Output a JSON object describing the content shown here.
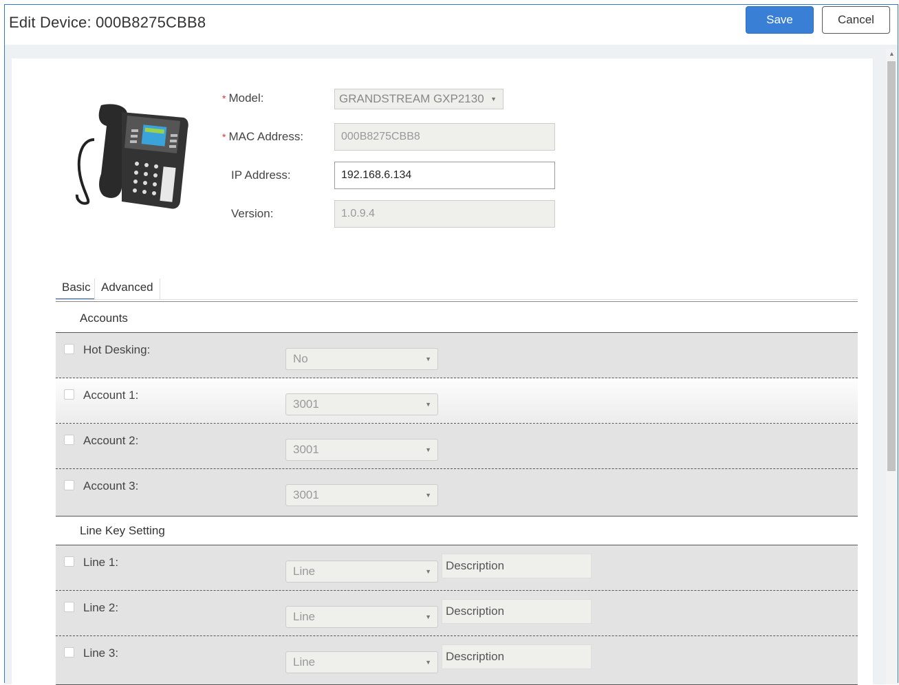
{
  "header": {
    "title": "Edit Device: 000B8275CBB8",
    "save_label": "Save",
    "cancel_label": "Cancel",
    "save_color": "#3a7fd6"
  },
  "device": {
    "image_icon": "desk-phone-image",
    "fields": {
      "model_label": "Model:",
      "model_value": "GRANDSTREAM GXP2130",
      "mac_label": "MAC Address:",
      "mac_value": "000B8275CBB8",
      "ip_label": "IP Address:",
      "ip_value": "192.168.6.134",
      "version_label": "Version:",
      "version_value": "1.0.9.4",
      "required_mark": "*"
    }
  },
  "tabs": [
    {
      "label": "Basic",
      "active": true
    },
    {
      "label": "Advanced",
      "active": false
    }
  ],
  "accounts": {
    "title": "Accounts",
    "rows": [
      {
        "label": "Hot Desking:",
        "value": "No"
      },
      {
        "label": "Account 1:",
        "value": "3001"
      },
      {
        "label": "Account 2:",
        "value": "3001"
      },
      {
        "label": "Account 3:",
        "value": "3001"
      }
    ]
  },
  "line_keys": {
    "title": "Line Key Setting",
    "rows": [
      {
        "label": "Line 1:",
        "value": "Line",
        "description": "Description"
      },
      {
        "label": "Line 2:",
        "value": "Line",
        "description": "Description"
      },
      {
        "label": "Line 3:",
        "value": "Line",
        "description": "Description"
      }
    ]
  },
  "icons": {
    "caret": "▼",
    "scroll_up": "▲"
  }
}
